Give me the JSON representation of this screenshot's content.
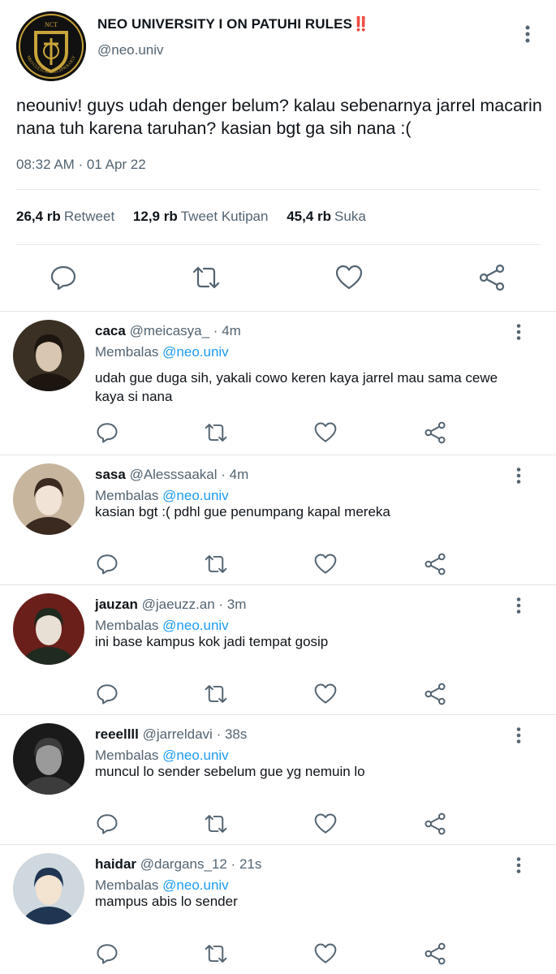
{
  "tweet": {
    "display_name": "NEO UNIVERSITY I ON PATUHI RULES‼️",
    "handle": "@neo.univ",
    "logo_text": "NCT",
    "logo_ring_text": "NEO CULTURE TECHNOLOGY",
    "text": "neouniv! guys udah denger belum? kalau sebenarnya jarrel macarin nana tuh karena taruhan? kasian bgt ga sih nana :(",
    "time": "08:32 AM · 01 Apr 22",
    "stats": [
      {
        "count": "26,4 rb",
        "label": "Retweet"
      },
      {
        "count": "12,9 rb",
        "label": "Tweet Kutipan"
      },
      {
        "count": "45,4 rb",
        "label": "Suka"
      }
    ]
  },
  "replies": [
    {
      "name": "caca",
      "handle": "@meicasya_",
      "time": "4m",
      "replying_label": "Membalas",
      "replying_to": "@neo.univ",
      "text": "udah gue duga sih, yakali cowo keren kaya jarrel mau sama cewe kaya si nana"
    },
    {
      "name": "sasa",
      "handle": "@Alesssaakal",
      "time": "4m",
      "replying_label": "Membalas",
      "replying_to": "@neo.univ",
      "text": "kasian bgt :( pdhl gue penumpang kapal mereka"
    },
    {
      "name": "jauzan",
      "handle": "@jaeuzz.an",
      "time": "3m",
      "replying_label": "Membalas",
      "replying_to": "@neo.univ",
      "text": "ini base kampus kok jadi tempat gosip"
    },
    {
      "name": "reeellll",
      "handle": "@jarreldavi",
      "time": "38s",
      "replying_label": "Membalas",
      "replying_to": "@neo.univ",
      "text": "muncul lo sender sebelum gue yg nemuin lo"
    },
    {
      "name": "haidar",
      "handle": "@dargans_12",
      "time": "21s",
      "replying_label": "Membalas",
      "replying_to": "@neo.univ",
      "text": "mampus abis lo sender"
    }
  ],
  "icons": {
    "reply": "reply-icon",
    "retweet": "retweet-icon",
    "like": "like-icon",
    "share": "share-icon",
    "more": "more-icon"
  },
  "colors": {
    "text": "#0f1419",
    "secondary": "#536471",
    "mention": "#1d9bf0",
    "logo_gold": "#c9a43a"
  }
}
